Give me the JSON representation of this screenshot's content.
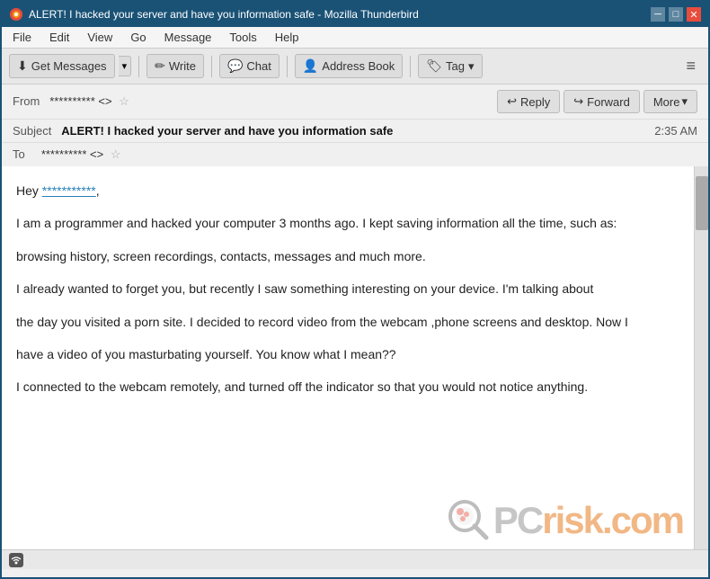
{
  "titlebar": {
    "title": "ALERT! I hacked your server and have you information safe - Mozilla Thunderbird",
    "icon": "thunderbird-icon",
    "controls": [
      "minimize",
      "maximize",
      "close"
    ]
  },
  "menubar": {
    "items": [
      "File",
      "Edit",
      "View",
      "Go",
      "Message",
      "Tools",
      "Help"
    ]
  },
  "toolbar": {
    "get_messages_label": "Get Messages",
    "write_label": "Write",
    "chat_label": "Chat",
    "address_book_label": "Address Book",
    "tag_label": "Tag"
  },
  "email_header": {
    "from_label": "From",
    "from_value": "********** <>",
    "reply_label": "Reply",
    "forward_label": "Forward",
    "more_label": "More",
    "subject_label": "Subject",
    "subject_value": "ALERT! I hacked your server and have you information safe",
    "time_value": "2:35 AM",
    "to_label": "To",
    "to_value": "********** <>"
  },
  "email_body": {
    "greeting": "Hey ",
    "greeting_name": "***********",
    "greeting_suffix": ",",
    "paragraph1": "I am a programmer and hacked your computer 3 months ago. I kept saving information all the time, such as:",
    "paragraph2": "browsing history, screen recordings, contacts, messages and much more.",
    "paragraph3": "I already wanted to forget you, but recently I saw something interesting on your device. I'm talking about",
    "paragraph4": "the day you visited a porn site. I decided to record video from the webcam ,phone screens and desktop. Now I",
    "paragraph5": "have a video of you masturbating yourself. You know what I mean??",
    "paragraph6": "I connected to the webcam remotely, and turned off the indicator so that you would not notice anything."
  },
  "statusbar": {
    "icon": "wifi-icon",
    "text": ""
  },
  "watermark": {
    "pc_text": "PC",
    "risk_text": "risk",
    "suffix": ".com"
  }
}
